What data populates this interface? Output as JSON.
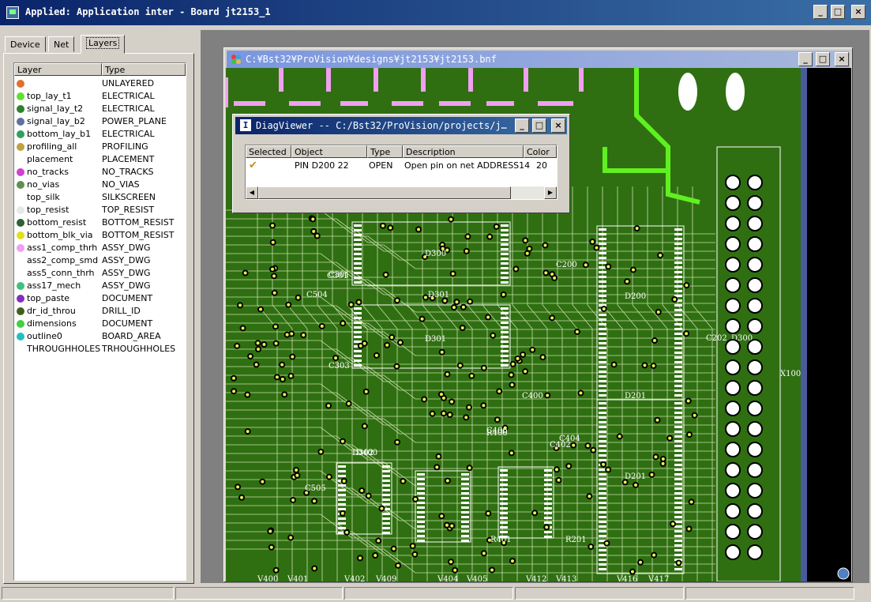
{
  "app": {
    "title": "Applied: Application inter - Board jt2153_1"
  },
  "window_buttons": {
    "minimize": "_",
    "maximize": "□",
    "close": "×"
  },
  "tabs": [
    "Device",
    "Net",
    "Layers"
  ],
  "layer_list": {
    "headers": [
      "Layer",
      "Type"
    ],
    "rows": [
      {
        "name": "",
        "type": "UNLAYERED",
        "color": "#e07030"
      },
      {
        "name": "top_lay_t1",
        "type": "ELECTRICAL",
        "color": "#60e030"
      },
      {
        "name": "signal_lay_t2",
        "type": "ELECTRICAL",
        "color": "#308030"
      },
      {
        "name": "signal_lay_b2",
        "type": "POWER_PLANE",
        "color": "#6070a0"
      },
      {
        "name": "bottom_lay_b1",
        "type": "ELECTRICAL",
        "color": "#30a060"
      },
      {
        "name": "profiling_all",
        "type": "PROFILING",
        "color": "#c0a040"
      },
      {
        "name": "placement",
        "type": "PLACEMENT",
        "color": ""
      },
      {
        "name": "no_tracks",
        "type": "NO_TRACKS",
        "color": "#d040d0"
      },
      {
        "name": "no_vias",
        "type": "NO_VIAS",
        "color": "#609050"
      },
      {
        "name": "top_silk",
        "type": "SILKSCREEN",
        "color": ""
      },
      {
        "name": "top_resist",
        "type": "TOP_RESIST",
        "color": "#e8e8e8"
      },
      {
        "name": "bottom_resist",
        "type": "BOTTOM_RESIST",
        "color": "#306030"
      },
      {
        "name": "bottom_blk_via",
        "type": "BOTTOM_RESIST",
        "color": "#e0e020"
      },
      {
        "name": "ass1_comp_thrh",
        "type": "ASSY_DWG",
        "color": "#f0a0f0"
      },
      {
        "name": "ass2_comp_smd",
        "type": "ASSY_DWG",
        "color": ""
      },
      {
        "name": "ass5_conn_thrh",
        "type": "ASSY_DWG",
        "color": ""
      },
      {
        "name": "ass17_mech",
        "type": "ASSY_DWG",
        "color": "#40c080"
      },
      {
        "name": "top_paste",
        "type": "DOCUMENT",
        "color": "#8030c0"
      },
      {
        "name": "dr_id_throu",
        "type": "DRILL_ID",
        "color": "#406020"
      },
      {
        "name": "dimensions",
        "type": "DOCUMENT",
        "color": "#40d040"
      },
      {
        "name": "outline0",
        "type": "BOARD_AREA",
        "color": "#20c0c0"
      },
      {
        "name": "THROUGHHOLES",
        "type": "TRHOUGHHOLES",
        "color": ""
      }
    ]
  },
  "child_window": {
    "title": "C:¥Bst32¥ProVision¥designs¥jt2153¥jt2153.bnf"
  },
  "diag": {
    "title": "DiagViewer   -- C:/Bst32/ProVision/projects/j…",
    "headers": [
      "Selected",
      "Object",
      "Type",
      "Description",
      "Color"
    ],
    "row": {
      "selected": "✔",
      "object": "PIN D200 22",
      "type": "OPEN",
      "description": "Open pin on net ADDRESS14",
      "color": "20"
    }
  },
  "board_labels": [
    "D300",
    "D301",
    "D301",
    "C301",
    "C303",
    "D200",
    "C200",
    "D201",
    "D201",
    "C400",
    "X100",
    "C202",
    "D300",
    "D400",
    "C406",
    "R406",
    "R401",
    "R201",
    "C404",
    "C402",
    "C504",
    "C505",
    "V400",
    "V401",
    "V402",
    "V409",
    "V404",
    "V405",
    "V412",
    "V413",
    "V416",
    "V417",
    "C301",
    "D302"
  ],
  "colors": {
    "board": "#2f6f12",
    "trace": "#d8e8c0",
    "pad": "#e8f050",
    "highlight": "#60f020",
    "pink": "#f0a0f0"
  }
}
